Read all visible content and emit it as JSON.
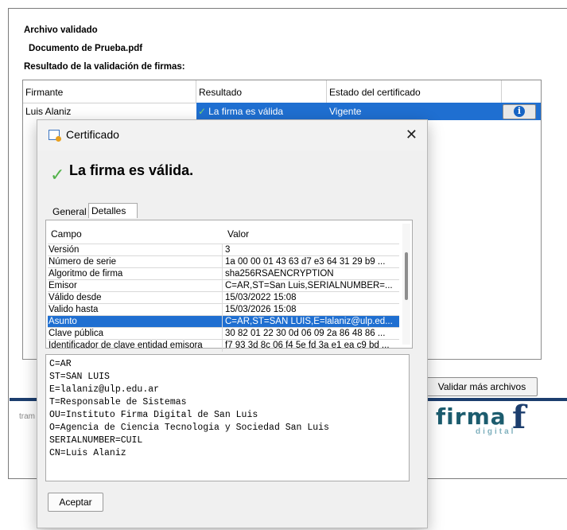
{
  "main": {
    "heading": "Archivo validado",
    "file_name": "Documento de Prueba.pdf",
    "results_heading": "Resultado de la validación de firmas:",
    "columns": [
      "Firmante",
      "Resultado",
      "Estado del certificado"
    ],
    "row": {
      "signer": "Luis Alaniz",
      "result": "La firma es válida",
      "state": "Vigente"
    },
    "info_icon": "info-icon",
    "validate_more_label": "Validar más archivos",
    "footer_text": "tram",
    "logo_main": "firma",
    "logo_sub": "digital",
    "logo_f": "f"
  },
  "dialog": {
    "title": "Certificado",
    "close_glyph": "✕",
    "status": "La firma es válida.",
    "tabs": [
      "General",
      "Detalles"
    ],
    "field_header": "Campo",
    "value_header": "Valor",
    "rows": [
      {
        "field": "Versión",
        "value": "3"
      },
      {
        "field": "Número de serie",
        "value": "1a 00 00 01 43 63 d7 e3 64 31 29 b9 ..."
      },
      {
        "field": "Algoritmo de firma",
        "value": "sha256RSAENCRYPTION"
      },
      {
        "field": "Emisor",
        "value": "C=AR,ST=San Luis,SERIALNUMBER=..."
      },
      {
        "field": "Válido desde",
        "value": "15/03/2022 15:08"
      },
      {
        "field": "Valido hasta",
        "value": "15/03/2026 15:08"
      },
      {
        "field": "Asunto",
        "value": "C=AR,ST=SAN LUIS,E=lalaniz@ulp.ed..."
      },
      {
        "field": "Clave pública",
        "value": "30 82 01 22 30 0d 06 09 2a 86 48 86 ..."
      },
      {
        "field": "Identificador de clave entidad emisora",
        "value": "f7 93 3d 8c 06 f4 5e fd 3a e1 ea c9 bd ..."
      }
    ],
    "selected_row": 6,
    "subject_lines": [
      "C=AR",
      "ST=SAN LUIS",
      "E=lalaniz@ulp.edu.ar",
      "T=Responsable de Sistemas",
      "OU=Instituto Firma Digital de San Luis",
      "O=Agencia de Ciencia  Tecnologia y Sociedad San Luis",
      "SERIALNUMBER=CUIL",
      "CN=Luis Alaniz"
    ],
    "ok_label": "Aceptar"
  },
  "colors": {
    "selection": "#1f6fd1",
    "check": "#52b24a",
    "brand_dark": "#1c3e6e",
    "brand_teal": "#1c5c6e"
  }
}
